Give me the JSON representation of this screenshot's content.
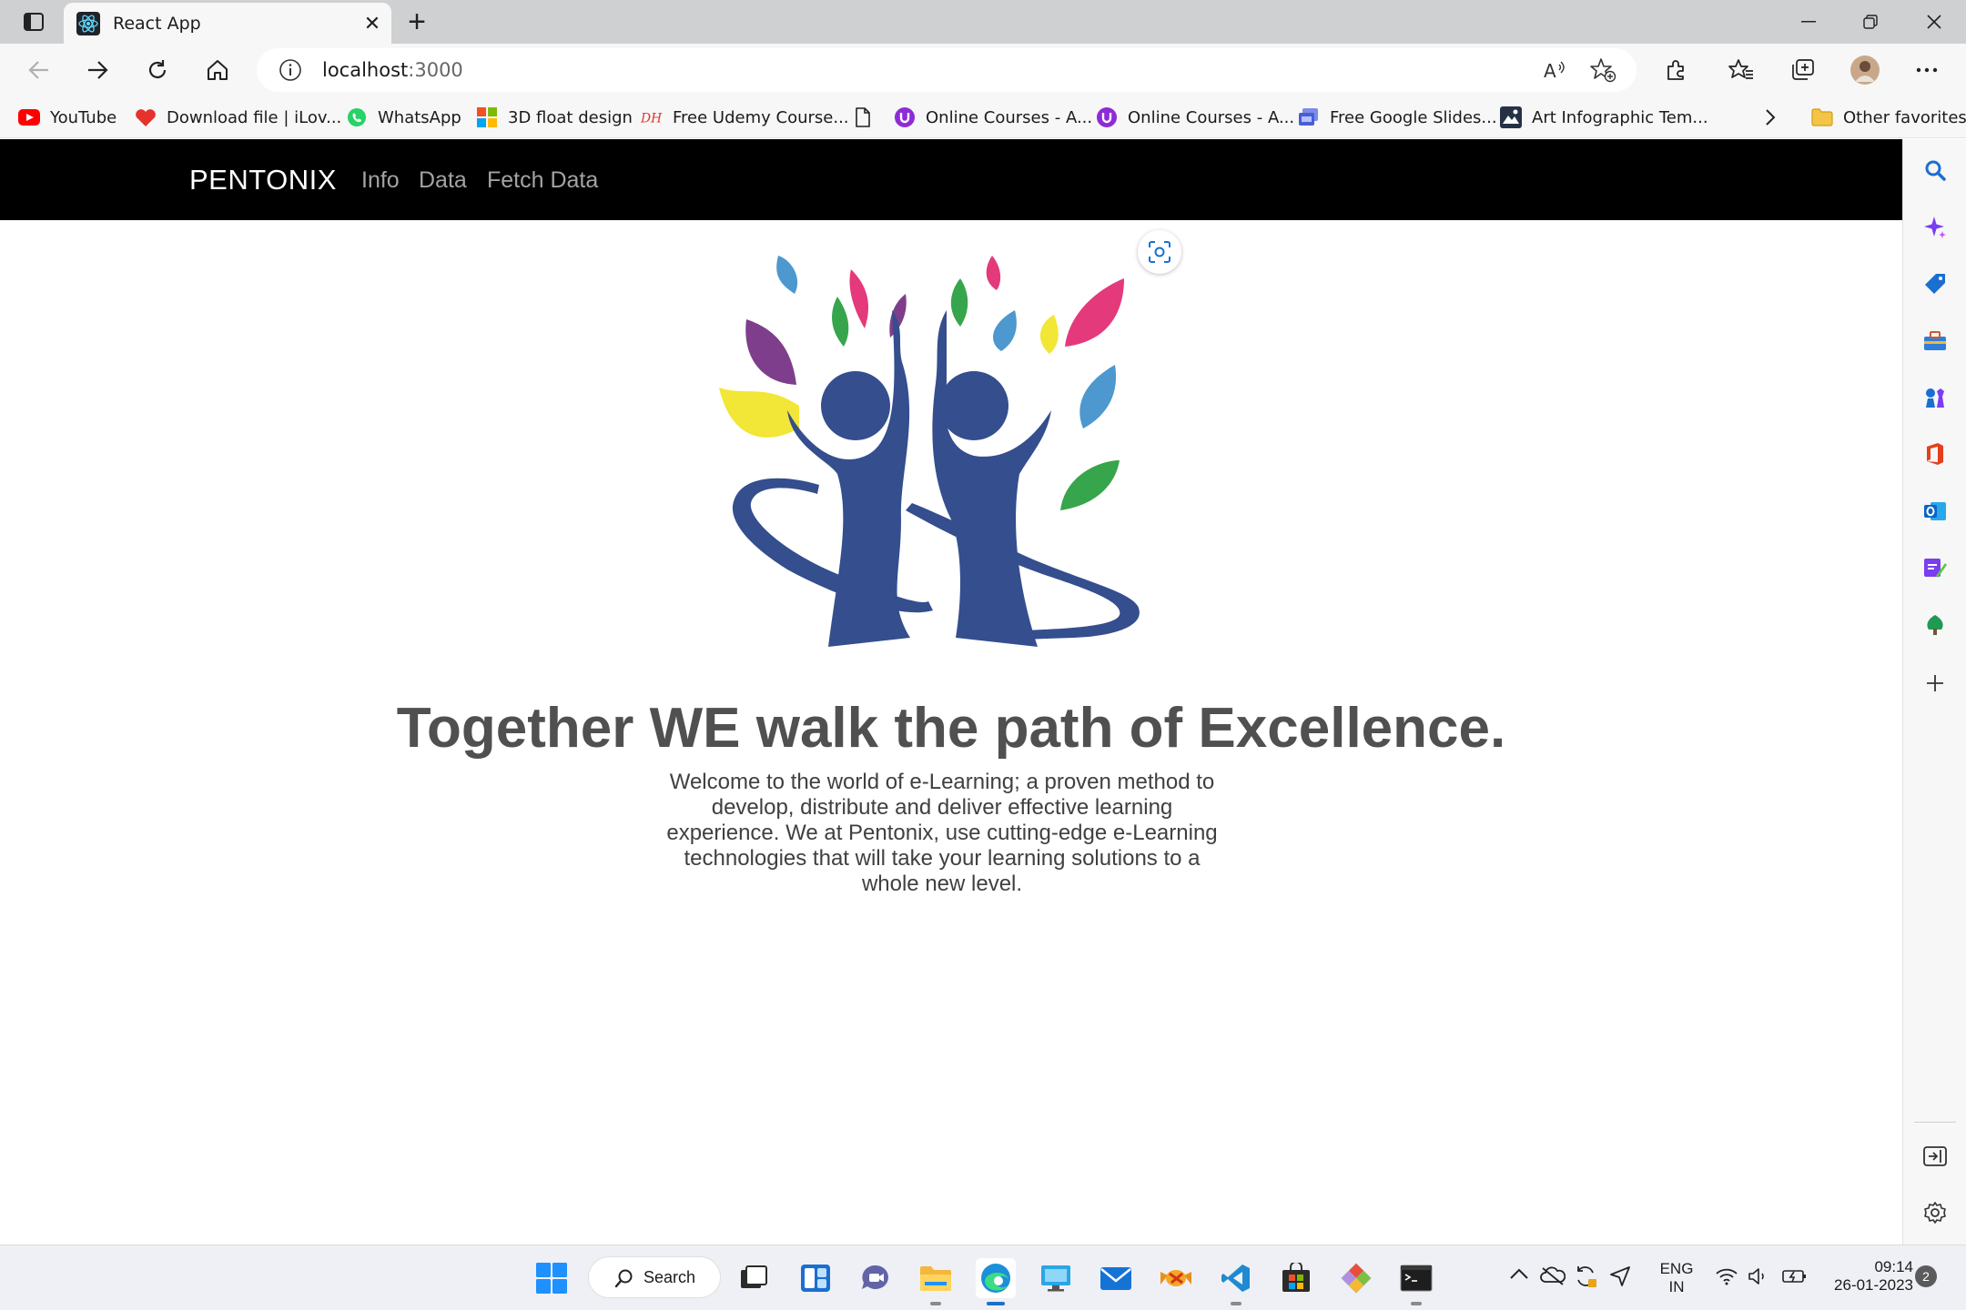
{
  "browser": {
    "tab": {
      "title": "React App",
      "favicon": "react-icon"
    },
    "url": {
      "host": "localhost",
      "port": ":3000"
    },
    "favorites": [
      {
        "label": "YouTube",
        "icon": "youtube-icon"
      },
      {
        "label": "Download file | iLov...",
        "icon": "heart-icon"
      },
      {
        "label": "WhatsApp",
        "icon": "whatsapp-icon"
      },
      {
        "label": "3D float design",
        "icon": "windows-grid-icon"
      },
      {
        "label": "Free Udemy Course...",
        "icon": "udemy-icon"
      },
      {
        "label": "",
        "icon": "page-icon"
      },
      {
        "label": "Online Courses - A...",
        "icon": "course-icon"
      },
      {
        "label": "Online Courses - A...",
        "icon": "course-icon"
      },
      {
        "label": "Free Google Slides...",
        "icon": "slides-icon"
      },
      {
        "label": "Art Infographic Tem...",
        "icon": "art-icon"
      }
    ],
    "other_favorites": "Other favorites"
  },
  "site": {
    "brand": "PENTONIX",
    "nav": [
      "Info",
      "Data",
      "Fetch Data"
    ],
    "headline": "Together WE walk the path of Excellence.",
    "lead": "Welcome to the world of e-Learning; a proven method to develop, distribute and deliver effective learning experience. We at Pentonix, use cutting-edge e-Learning technologies that will take your learning solutions to a whole new level."
  },
  "taskbar": {
    "search_label": "Search",
    "lang_top": "ENG",
    "lang_bottom": "IN",
    "time": "09:14",
    "date": "26-01-2023",
    "notifications": "2"
  },
  "colors": {
    "navbar_bg": "#000000",
    "brand": "#ffffff",
    "navlink": "#a3a3a3",
    "logo_blue": "#344e8e",
    "leaf_pink": "#e4397b",
    "leaf_green": "#36a54b",
    "leaf_yellow": "#f2e636",
    "leaf_purple": "#7e3e8b",
    "leaf_lightblue": "#4c98cf"
  }
}
